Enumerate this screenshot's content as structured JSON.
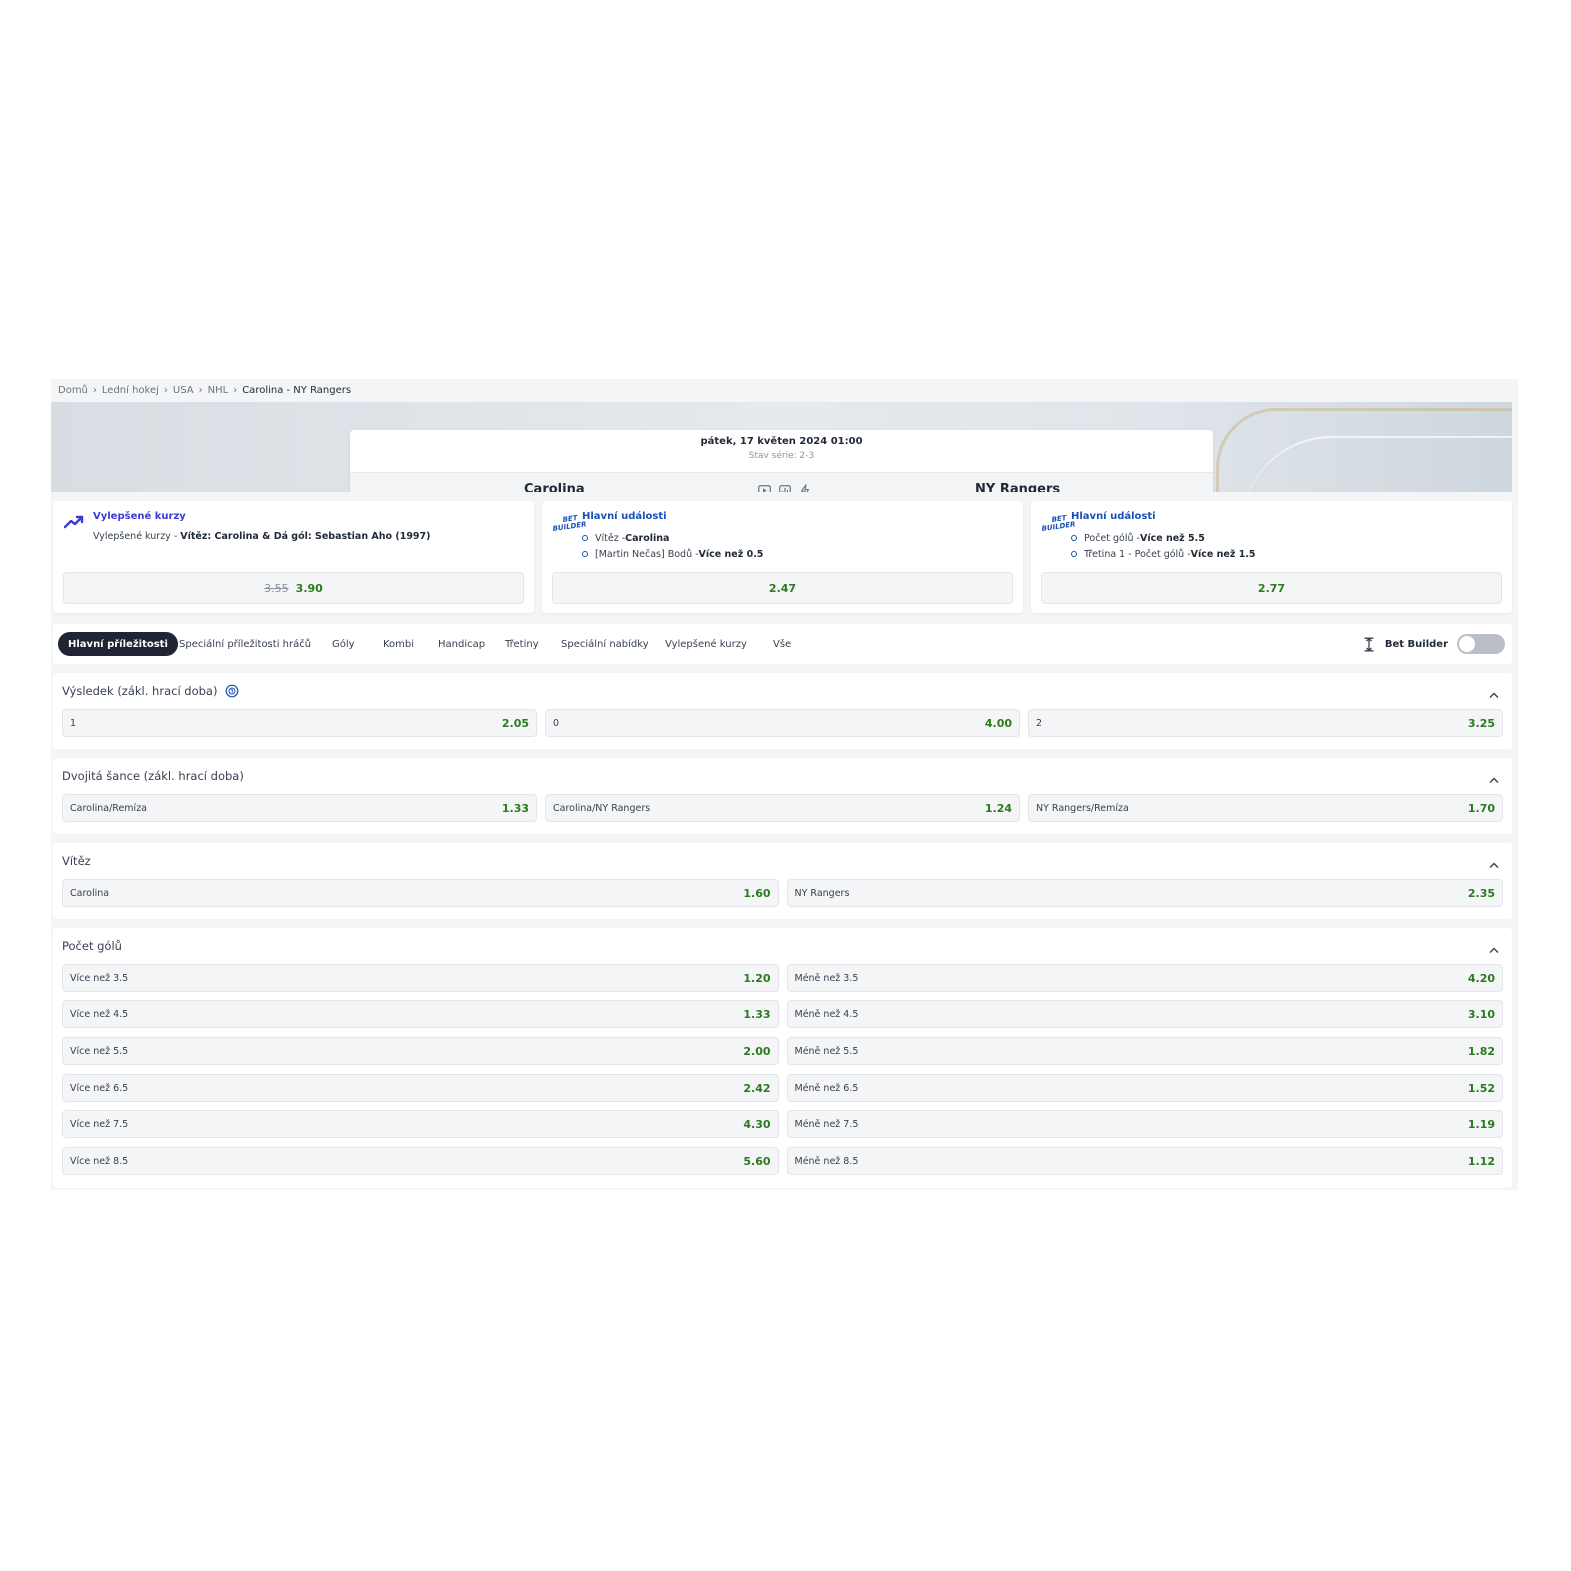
{
  "breadcrumb": [
    "Domů",
    "Lední hokej",
    "USA",
    "NHL",
    "Carolina - NY Rangers"
  ],
  "match": {
    "date": "pátek, 17 květen 2024 01:00",
    "series": "Stav série: 2-3",
    "home": "Carolina",
    "away": "NY Rangers"
  },
  "promos": [
    {
      "title": "Vylepšené kurzy",
      "desc_prefix": "Vylepšené kurzy - ",
      "desc_bold": "Vítěz: Carolina & Dá gól: Sebastian Aho (1997)",
      "old_odd": "3.55",
      "odd": "3.90"
    },
    {
      "title": "Hlavní události",
      "legs": [
        {
          "text": "Vítěz - ",
          "bold": "Carolina"
        },
        {
          "text": "[Martin Nečas] Bodů - ",
          "bold": "Více než 0.5"
        }
      ],
      "odd": "2.47"
    },
    {
      "title": "Hlavní události",
      "legs": [
        {
          "text": "Počet gólů - ",
          "bold": "Více než 5.5"
        },
        {
          "text": "Třetina 1 - Počet gólů - ",
          "bold": "Více než 1.5"
        }
      ],
      "odd": "2.77"
    }
  ],
  "bet_builder_badge": [
    "BET",
    "BUILDER"
  ],
  "tabs": [
    "Hlavní příležitosti",
    "Speciální příležitosti hráčů",
    "Góly",
    "Kombi",
    "Handicap",
    "Třetiny",
    "Speciální nabídky",
    "Vylepšené kurzy",
    "Vše"
  ],
  "bet_builder_label": "Bet Builder",
  "bet_builder_on": false,
  "markets": [
    {
      "title": "Výsledek (zákl. hrací doba)",
      "rows": [
        [
          [
            "1",
            "2.05"
          ],
          [
            "0",
            "4.00"
          ],
          [
            "2",
            "3.25"
          ]
        ]
      ]
    },
    {
      "title": "Dvojitá šance (zákl. hrací doba)",
      "rows": [
        [
          [
            "Carolina/Remíza",
            "1.33"
          ],
          [
            "Carolina/NY Rangers",
            "1.24"
          ],
          [
            "NY Rangers/Remíza",
            "1.70"
          ]
        ]
      ]
    },
    {
      "title": "Vítěz",
      "rows": [
        [
          [
            "Carolina",
            "1.60"
          ],
          [
            "NY Rangers",
            "2.35"
          ]
        ]
      ]
    },
    {
      "title": "Počet gólů",
      "rows": [
        [
          [
            "Více než 3.5",
            "1.20"
          ],
          [
            "Méně než 3.5",
            "4.20"
          ]
        ],
        [
          [
            "Více než 4.5",
            "1.33"
          ],
          [
            "Méně než 4.5",
            "3.10"
          ]
        ],
        [
          [
            "Více než 5.5",
            "2.00"
          ],
          [
            "Méně než 5.5",
            "1.82"
          ]
        ],
        [
          [
            "Více než 6.5",
            "2.42"
          ],
          [
            "Méně než 6.5",
            "1.52"
          ]
        ],
        [
          [
            "Více než 7.5",
            "4.30"
          ],
          [
            "Méně než 7.5",
            "1.19"
          ]
        ],
        [
          [
            "Více než 8.5",
            "5.60"
          ],
          [
            "Méně než 8.5",
            "1.12"
          ]
        ]
      ]
    }
  ],
  "colors": {
    "odd_green": "#2a7a1e",
    "boost_purple": "#3a3ad6",
    "bb_blue": "#1b4fb8",
    "active_tab": "#1f2535"
  }
}
